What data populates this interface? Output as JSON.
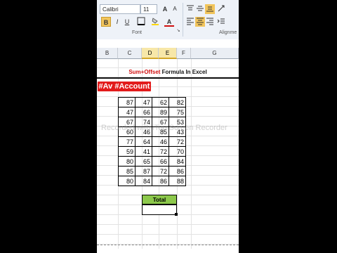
{
  "ribbon": {
    "font_name": "Calibri",
    "font_size": "11",
    "font_group_label": "Font",
    "alignment_group_label": "Alignme",
    "bold_label": "B",
    "italic_label": "I",
    "underline_label": "U",
    "grow_font_label": "A",
    "shrink_font_label": "A",
    "font_color_label": "A"
  },
  "columns": [
    "B",
    "C",
    "D",
    "E",
    "F",
    "G"
  ],
  "sheet": {
    "title_red": "Sum+Offset",
    "title_black": " Formula In Excel",
    "hashtag": "#Av #Account",
    "watermark": "Recorded with iTop Screen Recorder",
    "total_label": "Total",
    "rows": [
      [
        87,
        47,
        62,
        82
      ],
      [
        47,
        66,
        89,
        75
      ],
      [
        67,
        74,
        67,
        53
      ],
      [
        60,
        46,
        85,
        43
      ],
      [
        77,
        64,
        46,
        72
      ],
      [
        59,
        41,
        72,
        70
      ],
      [
        80,
        65,
        66,
        84
      ],
      [
        85,
        87,
        72,
        86
      ],
      [
        80,
        84,
        86,
        88
      ]
    ]
  },
  "colors": {
    "accent_red": "#e21b1b",
    "total_green": "#8cc84b",
    "selected_col_header": "#f7e7a8"
  }
}
